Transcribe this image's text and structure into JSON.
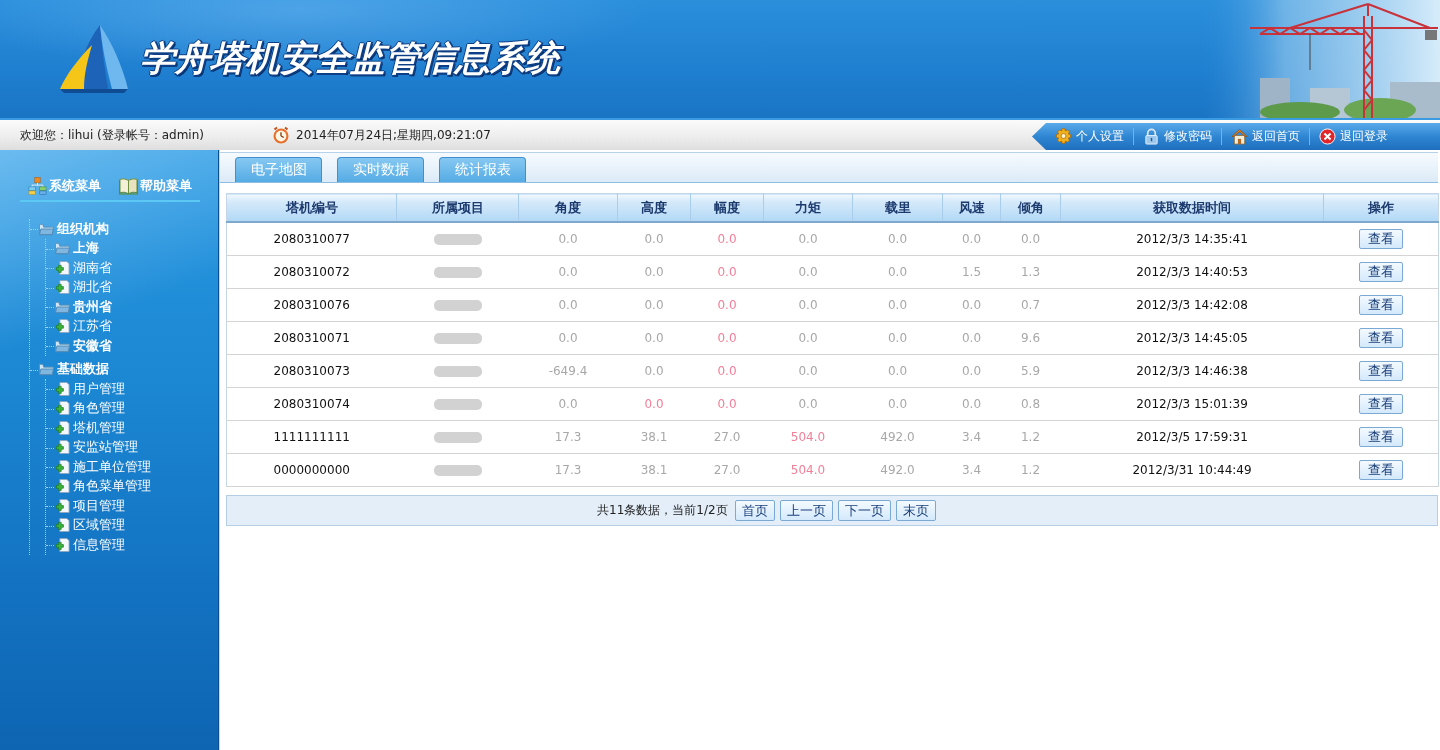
{
  "header": {
    "title": "学舟塔机安全监管信息系统"
  },
  "top_bar": {
    "welcome": "欢迎您：lihui (登录帐号：admin)",
    "datetime": "2014年07月24日;星期四,09:21:07",
    "links": [
      {
        "kind": "settings",
        "label": "个人设置"
      },
      {
        "kind": "password",
        "label": "修改密码"
      },
      {
        "kind": "home",
        "label": "返回首页"
      },
      {
        "kind": "logout",
        "label": "退回登录"
      }
    ]
  },
  "sidebar": {
    "menus": [
      {
        "kind": "system",
        "label": "系统菜单"
      },
      {
        "kind": "help",
        "label": "帮助菜单"
      }
    ],
    "tree": [
      {
        "kind": "folder",
        "label": "组织机构",
        "children": [
          {
            "kind": "folder",
            "label": "上海"
          },
          {
            "kind": "leaf",
            "label": "湖南省"
          },
          {
            "kind": "leaf",
            "label": "湖北省"
          },
          {
            "kind": "folder",
            "label": "贵州省"
          },
          {
            "kind": "leaf",
            "label": "江苏省"
          },
          {
            "kind": "folder",
            "label": "安徽省"
          }
        ]
      },
      {
        "kind": "folder",
        "label": "基础数据",
        "children": [
          {
            "kind": "leaf",
            "label": "用户管理"
          },
          {
            "kind": "leaf",
            "label": "角色管理"
          },
          {
            "kind": "leaf",
            "label": "塔机管理"
          },
          {
            "kind": "leaf",
            "label": "安监站管理"
          },
          {
            "kind": "leaf",
            "label": "施工单位管理"
          },
          {
            "kind": "leaf",
            "label": "角色菜单管理"
          },
          {
            "kind": "leaf",
            "label": "项目管理"
          },
          {
            "kind": "leaf",
            "label": "区域管理"
          },
          {
            "kind": "leaf",
            "label": "信息管理"
          }
        ]
      }
    ]
  },
  "tabs": [
    {
      "label": "电子地图",
      "selected": false
    },
    {
      "label": "实时数据",
      "selected": false
    },
    {
      "label": "统计报表",
      "selected": false
    }
  ],
  "table": {
    "columns": [
      "塔机编号",
      "所属项目",
      "角度",
      "高度",
      "幅度",
      "力矩",
      "载里",
      "风速",
      "倾角",
      "获取数据时间",
      "操作"
    ],
    "rows": [
      {
        "tower_id": "2080310077",
        "readings": [
          {
            "text": "0.0",
            "alarm": false
          },
          {
            "text": "0.0",
            "alarm": false
          },
          {
            "text": "0.0",
            "alarm": true
          },
          {
            "text": "0.0",
            "alarm": false
          },
          {
            "text": "0.0",
            "alarm": false
          },
          {
            "text": "0.0",
            "alarm": false
          },
          {
            "text": "0.0",
            "alarm": false
          }
        ],
        "time": "2012/3/3 14:35:41",
        "action": "查看"
      },
      {
        "tower_id": "2080310072",
        "readings": [
          {
            "text": "0.0",
            "alarm": false
          },
          {
            "text": "0.0",
            "alarm": false
          },
          {
            "text": "0.0",
            "alarm": true
          },
          {
            "text": "0.0",
            "alarm": false
          },
          {
            "text": "0.0",
            "alarm": false
          },
          {
            "text": "1.5",
            "alarm": false
          },
          {
            "text": "1.3",
            "alarm": false
          }
        ],
        "time": "2012/3/3 14:40:53",
        "action": "查看"
      },
      {
        "tower_id": "2080310076",
        "readings": [
          {
            "text": "0.0",
            "alarm": false
          },
          {
            "text": "0.0",
            "alarm": false
          },
          {
            "text": "0.0",
            "alarm": true
          },
          {
            "text": "0.0",
            "alarm": false
          },
          {
            "text": "0.0",
            "alarm": false
          },
          {
            "text": "0.0",
            "alarm": false
          },
          {
            "text": "0.7",
            "alarm": false
          }
        ],
        "time": "2012/3/3 14:42:08",
        "action": "查看"
      },
      {
        "tower_id": "2080310071",
        "readings": [
          {
            "text": "0.0",
            "alarm": false
          },
          {
            "text": "0.0",
            "alarm": false
          },
          {
            "text": "0.0",
            "alarm": true
          },
          {
            "text": "0.0",
            "alarm": false
          },
          {
            "text": "0.0",
            "alarm": false
          },
          {
            "text": "0.0",
            "alarm": false
          },
          {
            "text": "9.6",
            "alarm": false
          }
        ],
        "time": "2012/3/3 14:45:05",
        "action": "查看"
      },
      {
        "tower_id": "2080310073",
        "readings": [
          {
            "text": "-649.4",
            "alarm": false
          },
          {
            "text": "0.0",
            "alarm": false
          },
          {
            "text": "0.0",
            "alarm": true
          },
          {
            "text": "0.0",
            "alarm": false
          },
          {
            "text": "0.0",
            "alarm": false
          },
          {
            "text": "0.0",
            "alarm": false
          },
          {
            "text": "5.9",
            "alarm": false
          }
        ],
        "time": "2012/3/3 14:46:38",
        "action": "查看"
      },
      {
        "tower_id": "2080310074",
        "readings": [
          {
            "text": "0.0",
            "alarm": false
          },
          {
            "text": "0.0",
            "alarm": true
          },
          {
            "text": "0.0",
            "alarm": true
          },
          {
            "text": "0.0",
            "alarm": false
          },
          {
            "text": "0.0",
            "alarm": false
          },
          {
            "text": "0.0",
            "alarm": false
          },
          {
            "text": "0.8",
            "alarm": false
          }
        ],
        "time": "2012/3/3 15:01:39",
        "action": "查看"
      },
      {
        "tower_id": "1111111111",
        "readings": [
          {
            "text": "17.3",
            "alarm": false
          },
          {
            "text": "38.1",
            "alarm": false
          },
          {
            "text": "27.0",
            "alarm": false
          },
          {
            "text": "504.0",
            "alarm": true
          },
          {
            "text": "492.0",
            "alarm": false
          },
          {
            "text": "3.4",
            "alarm": false
          },
          {
            "text": "1.2",
            "alarm": false
          }
        ],
        "time": "2012/3/5 17:59:31",
        "action": "查看"
      },
      {
        "tower_id": "0000000000",
        "readings": [
          {
            "text": "17.3",
            "alarm": false
          },
          {
            "text": "38.1",
            "alarm": false
          },
          {
            "text": "27.0",
            "alarm": false
          },
          {
            "text": "504.0",
            "alarm": true
          },
          {
            "text": "492.0",
            "alarm": false
          },
          {
            "text": "3.4",
            "alarm": false
          },
          {
            "text": "1.2",
            "alarm": false
          }
        ],
        "time": "2012/3/31 10:44:49",
        "action": "查看"
      }
    ]
  },
  "pagination": {
    "summary": "共11条数据，当前1/2页",
    "buttons": [
      "首页",
      "上一页",
      "下一页",
      "末页"
    ]
  }
}
